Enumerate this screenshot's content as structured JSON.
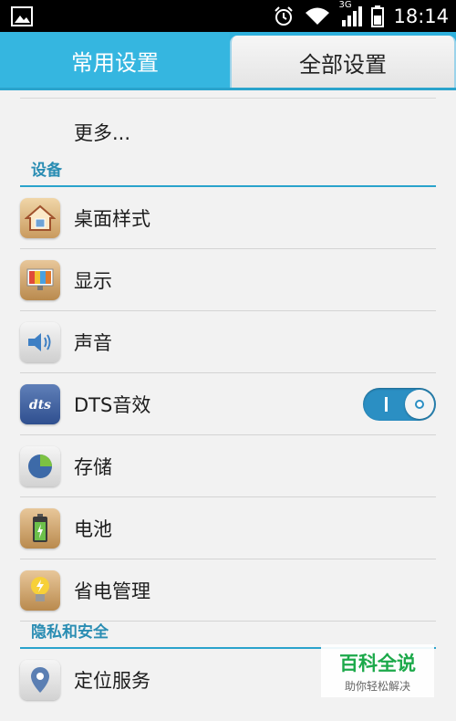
{
  "status_bar": {
    "time": "18:14",
    "network": "3G",
    "icons": [
      "image-icon",
      "alarm-icon",
      "wifi-icon",
      "signal-icon",
      "battery-icon"
    ]
  },
  "tabs": [
    {
      "label": "常用设置",
      "selected": false
    },
    {
      "label": "全部设置",
      "selected": true
    }
  ],
  "more_item": {
    "label": "更多..."
  },
  "sections": [
    {
      "title": "设备"
    },
    {
      "title": "隐私和安全"
    }
  ],
  "device_items": [
    {
      "label": "桌面样式",
      "icon": "home-icon"
    },
    {
      "label": "显示",
      "icon": "display-icon"
    },
    {
      "label": "声音",
      "icon": "speaker-icon"
    },
    {
      "label": "DTS音效",
      "icon": "dts-icon",
      "toggle": true
    },
    {
      "label": "存储",
      "icon": "storage-pie-icon"
    },
    {
      "label": "电池",
      "icon": "battery-icon"
    },
    {
      "label": "省电管理",
      "icon": "lightbulb-icon"
    }
  ],
  "privacy_items": [
    {
      "label": "定位服务",
      "icon": "location-pin-icon"
    }
  ],
  "watermark": {
    "title": "百科全说",
    "subtitle": "助你轻松解决"
  },
  "colors": {
    "accent": "#2eb0dc",
    "section_text": "#2a8db3",
    "toggle_on": "#2b8fc3"
  }
}
